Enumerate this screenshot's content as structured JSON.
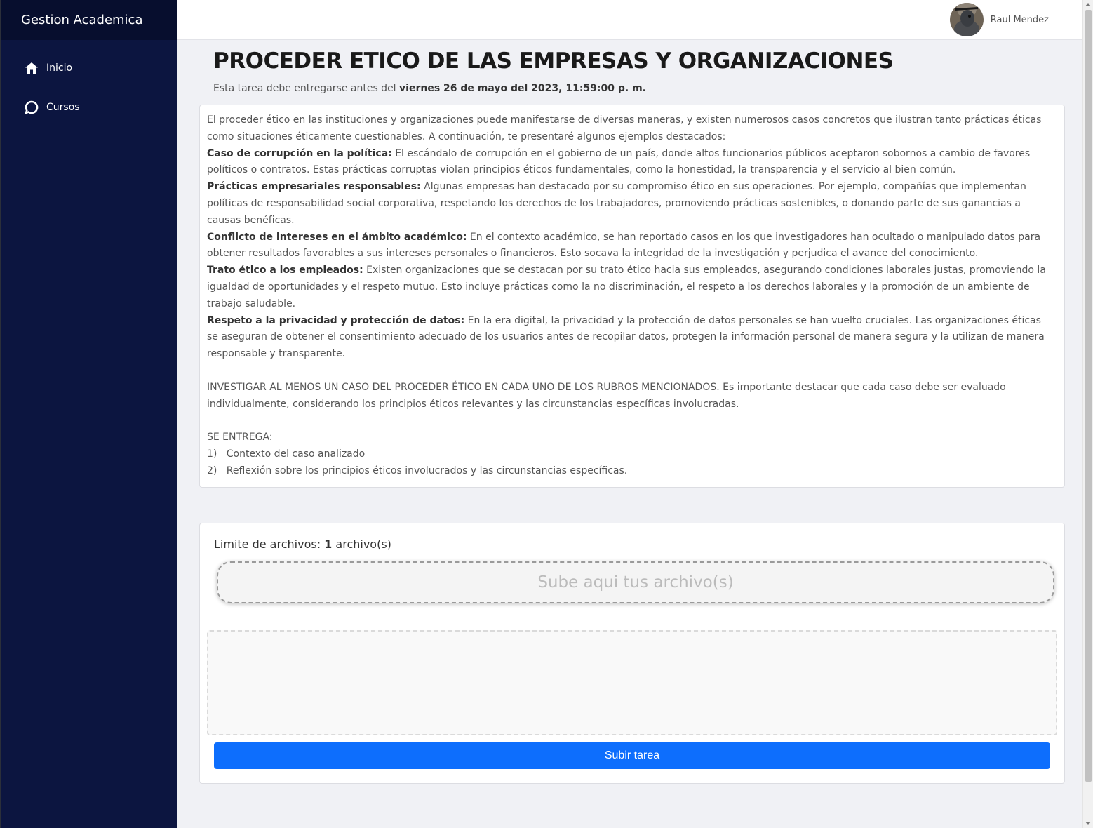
{
  "sidebar": {
    "brand": "Gestion Academica",
    "items": [
      {
        "label": "Inicio",
        "icon": "home-icon"
      },
      {
        "label": "Cursos",
        "icon": "chat-bubble-icon"
      }
    ]
  },
  "topbar": {
    "user_name": "Raul Mendez",
    "avatar": "user-avatar"
  },
  "assignment": {
    "title": "PROCEDER ETICO DE LAS EMPRESAS Y ORGANIZACIONES",
    "due_prefix": "Esta tarea debe entregarse antes del",
    "due_date": "viernes 26 de mayo del 2023, 11:59:00 p. m.",
    "intro": "El proceder ético en las instituciones y organizaciones puede manifestarse de diversas maneras, y existen numerosos casos concretos que ilustran tanto prácticas éticas como situaciones éticamente cuestionables. A continuación, te presentaré algunos ejemplos destacados:",
    "sections": [
      {
        "heading": "Caso de corrupción en la política:",
        "text": "El escándalo de corrupción en el gobierno de un país, donde altos funcionarios públicos aceptaron sobornos a cambio de favores políticos o contratos. Estas prácticas corruptas violan principios éticos fundamentales, como la honestidad, la transparencia y el servicio al bien común."
      },
      {
        "heading": "Prácticas empresariales responsables:",
        "text": "Algunas empresas han destacado por su compromiso ético en sus operaciones. Por ejemplo, compañías que implementan políticas de responsabilidad social corporativa, respetando los derechos de los trabajadores, promoviendo prácticas sostenibles, o donando parte de sus ganancias a causas benéficas."
      },
      {
        "heading": "Conflicto de intereses en el ámbito académico:",
        "text": "En el contexto académico, se han reportado casos en los que investigadores han ocultado o manipulado datos para obtener resultados favorables a sus intereses personales o financieros. Esto socava la integridad de la investigación y perjudica el avance del conocimiento."
      },
      {
        "heading": "Trato ético a los empleados:",
        "text": "Existen organizaciones que se destacan por su trato ético hacia sus empleados, asegurando condiciones laborales justas, promoviendo la igualdad de oportunidades y el respeto mutuo. Esto incluye prácticas como la no discriminación, el respeto a los derechos laborales y la promoción de un ambiente de trabajo saludable."
      },
      {
        "heading": "Respeto a la privacidad y protección de datos:",
        "text": "En la era digital, la privacidad y la protección de datos personales se han vuelto cruciales. Las organizaciones éticas se aseguran de obtener el consentimiento adecuado de los usuarios antes de recopilar datos, protegen la información personal de manera segura y la utilizan de manera responsable y transparente."
      }
    ],
    "instruction": "INVESTIGAR AL MENOS UN CASO DEL PROCEDER ÉTICO EN CADA UNO DE LOS RUBROS MENCIONADOS. Es importante destacar que cada caso debe ser evaluado individualmente, considerando los principios éticos relevantes y las circunstancias específicas involucradas.",
    "deliver_label": "SE ENTREGA:",
    "deliverables": [
      {
        "num": "1)",
        "text": "Contexto del caso analizado"
      },
      {
        "num": "2)",
        "text": "Reflexión sobre los principios éticos involucrados y las circunstancias específicas."
      }
    ]
  },
  "upload": {
    "limit_label": "Limite de archivos:",
    "limit_value": "1",
    "limit_unit": "archivo(s)",
    "dropzone_text": "Sube aqui tus archivo(s)",
    "submit_label": "Subir tarea"
  },
  "colors": {
    "sidebar_bg": "#0c1540",
    "brand_bg": "#070e2e",
    "primary_button": "#0d6efd",
    "page_bg": "#f0f1f5"
  }
}
